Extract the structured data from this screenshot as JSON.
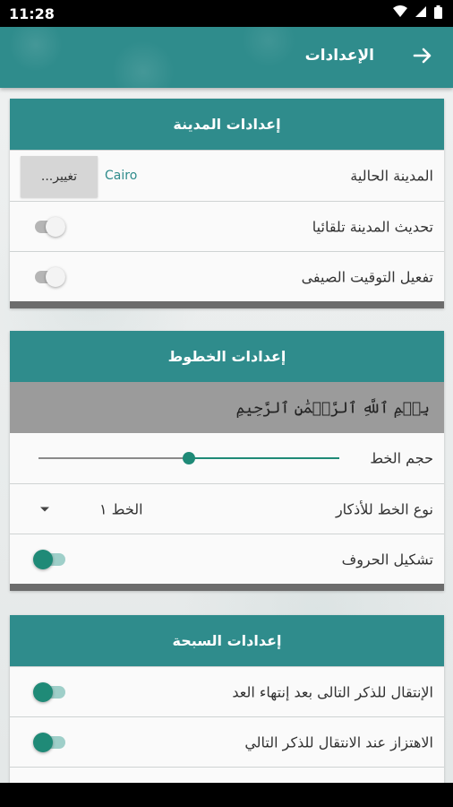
{
  "status_bar": {
    "time": "11:28",
    "icons": [
      "wifi-icon",
      "signal-icon",
      "battery-icon"
    ]
  },
  "toolbar": {
    "title": "الإعدادات",
    "back_icon": "arrow-right-icon"
  },
  "colors": {
    "primary": "#2f8c8c",
    "accent": "#1f8a77",
    "card_footer": "#6c6c6c",
    "preview_bg": "#9b9b9b"
  },
  "city_settings": {
    "header": "إعدادات المدينة",
    "current_city_label": "المدينة الحالية",
    "current_city_value": "Cairo",
    "change_button": "تغيير...",
    "auto_update_label": "تحديث المدينة تلقائيا",
    "auto_update_on": false,
    "dst_label": "تفعيل التوقيت الصيفى",
    "dst_on": false
  },
  "font_settings": {
    "header": "إعدادات الخطوط",
    "preview_text": "بِسۡمِ ٱللَّهِ ٱلرَّحۡمَٰنِ ٱلرَّحِيمِ",
    "font_size_label": "حجم الخط",
    "font_size_fraction": 0.5,
    "font_type_label": "نوع الخط للأذكار",
    "font_type_value": "الخط ١",
    "diacritics_label": "تشكيل الحروف",
    "diacritics_on": true
  },
  "tasbeeh_settings": {
    "header": "إعدادات السبحة",
    "auto_next_label": "الإنتقال للذكر التالى بعد إنتهاء العد",
    "auto_next_on": true,
    "vibrate_label": "الاهتزاز عند الانتقال للذكر التالي",
    "vibrate_on": true
  }
}
